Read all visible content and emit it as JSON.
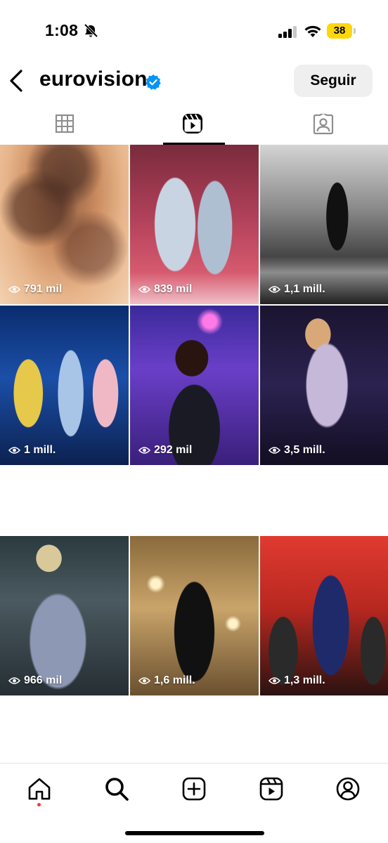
{
  "status_bar": {
    "time": "1:08",
    "battery": "38",
    "icons": [
      "bell-muted-icon",
      "cellular-signal-icon",
      "wifi-icon",
      "battery-icon"
    ]
  },
  "header": {
    "username": "eurovision",
    "follow_label": "Seguir",
    "icons": [
      "back-chevron-icon",
      "verified-badge-icon"
    ]
  },
  "tabs": [
    {
      "name": "grid",
      "icon": "grid-icon",
      "selected": false
    },
    {
      "name": "reels",
      "icon": "reels-icon",
      "selected": true
    },
    {
      "name": "tagged",
      "icon": "tagged-icon",
      "selected": false
    }
  ],
  "reels": [
    {
      "views": "791 mil"
    },
    {
      "views": "839 mil"
    },
    {
      "views": "1,1 mill."
    },
    {
      "views": "1 mill."
    },
    {
      "views": "292 mil"
    },
    {
      "views": "3,5 mill."
    },
    {
      "views": "966 mil"
    },
    {
      "views": "1,6 mill."
    },
    {
      "views": "1,3 mill."
    }
  ],
  "bottom_nav": [
    {
      "name": "home",
      "icon": "home-icon",
      "notification_dot": true
    },
    {
      "name": "search",
      "icon": "search-icon",
      "active": true
    },
    {
      "name": "create",
      "icon": "plus-square-icon"
    },
    {
      "name": "reels",
      "icon": "reels-icon"
    },
    {
      "name": "profile",
      "icon": "profile-icon"
    }
  ],
  "colors": {
    "follow_button_bg": "#efefef",
    "verified_blue": "#0095f6",
    "battery_yellow": "#ffd60a",
    "notification_red": "#ff3040"
  }
}
